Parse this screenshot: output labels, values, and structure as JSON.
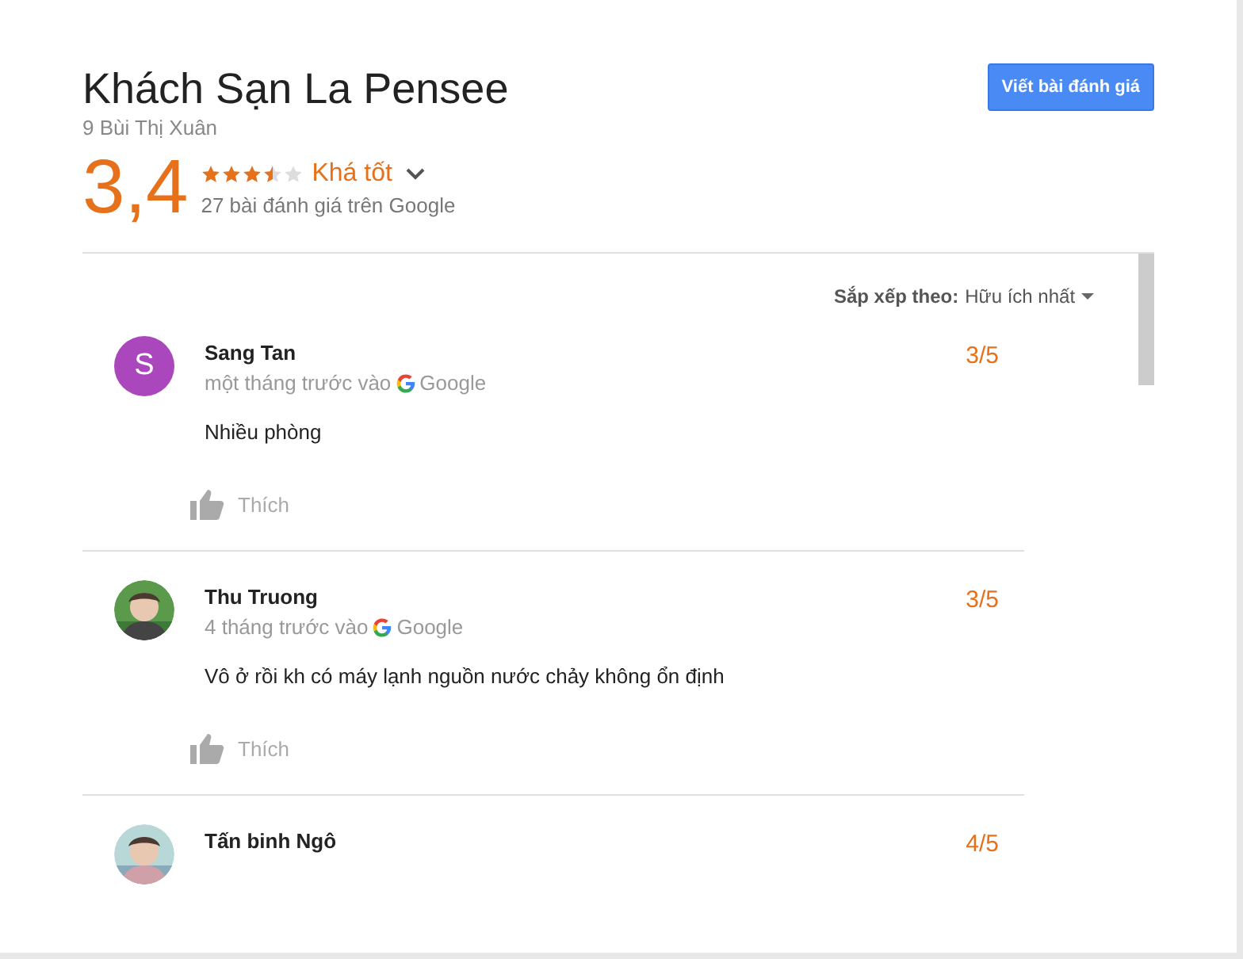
{
  "place": {
    "title": "Khách Sạn La Pensee",
    "address": "9 Bùi Thị Xuân",
    "score": "3,4",
    "stars": 3.5,
    "verdict": "Khá tốt",
    "count": "27 bài đánh giá trên Google"
  },
  "write_button": "Viết bài đánh giá",
  "sort": {
    "label": "Sắp xếp theo:",
    "value": "Hữu ích nhất"
  },
  "reviews": [
    {
      "name": "Sang Tan",
      "avatar": {
        "kind": "letter",
        "letter": "S",
        "color": "#ab47bc"
      },
      "time": "một tháng trước vào",
      "source": "Google",
      "text": "Nhiều phòng",
      "rating": "3/5",
      "like": "Thích"
    },
    {
      "name": "Thu Truong",
      "time": "4 tháng trước vào",
      "source": "Google",
      "text": "Vô ở rồi kh có máy lạnh nguồn nước chảy không ổn định",
      "rating": "3/5",
      "like": "Thích"
    },
    {
      "name": "Tấn binh Ngô",
      "rating": "4/5"
    }
  ]
}
